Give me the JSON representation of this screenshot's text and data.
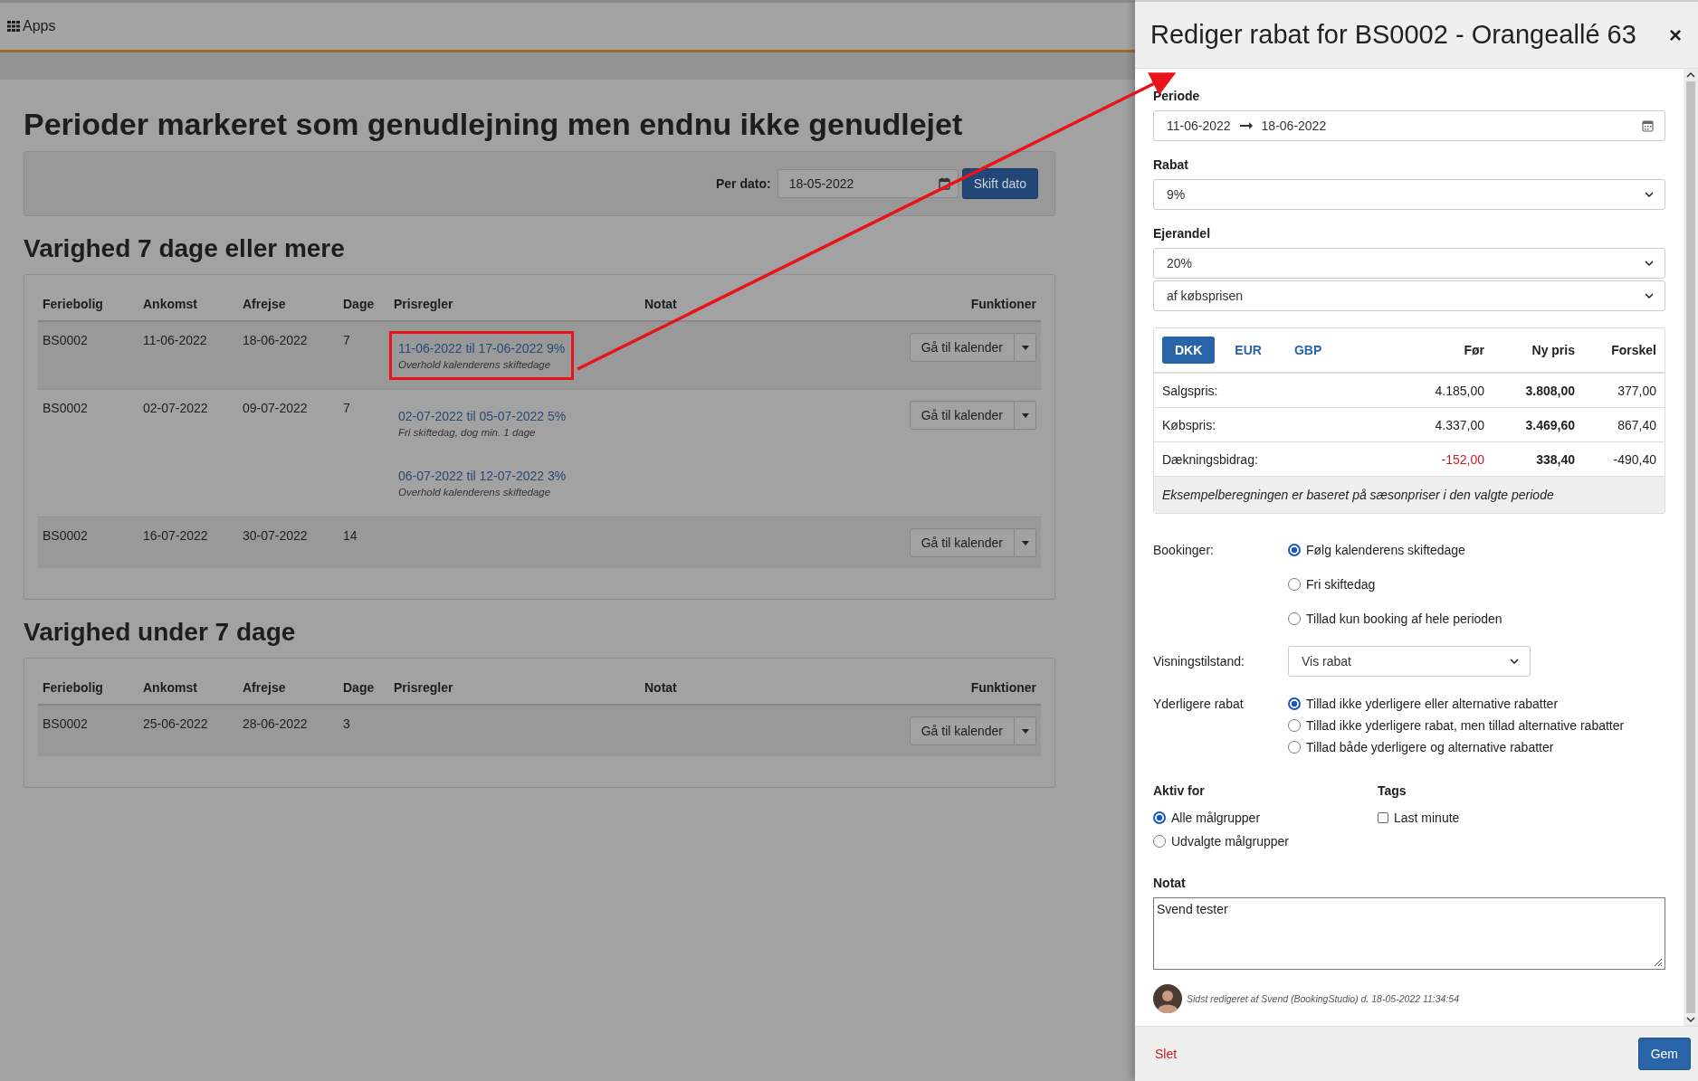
{
  "topbar": {
    "apps_label": "Apps"
  },
  "page_title": "Perioder markeret som genudlejning men endnu ikke genudlejet",
  "filter": {
    "label": "Per dato:",
    "date": "18-05-2022",
    "button": "Skift dato"
  },
  "sections": [
    {
      "title": "Varighed 7 dage eller mere",
      "columns": [
        "Feriebolig",
        "Ankomst",
        "Afrejse",
        "Dage",
        "Prisregler",
        "Notat",
        "Funktioner"
      ],
      "rows": [
        {
          "property": "BS0002",
          "arrival": "11-06-2022",
          "departure": "18-06-2022",
          "days": "7",
          "price_rules": [
            {
              "link": "11-06-2022 til 17-06-2022 9%",
              "note": "Overhold kalenderens skiftedage",
              "highlighted": true
            }
          ],
          "action": "Gå til kalender"
        },
        {
          "property": "BS0002",
          "arrival": "02-07-2022",
          "departure": "09-07-2022",
          "days": "7",
          "price_rules": [
            {
              "link": "02-07-2022 til 05-07-2022 5%",
              "note": "Fri skiftedag, dog min. 1 dage",
              "highlighted": false
            },
            {
              "link": "06-07-2022 til 12-07-2022 3%",
              "note": "Overhold kalenderens skiftedage",
              "highlighted": false
            }
          ],
          "action": "Gå til kalender"
        },
        {
          "property": "BS0002",
          "arrival": "16-07-2022",
          "departure": "30-07-2022",
          "days": "14",
          "price_rules": [],
          "action": "Gå til kalender"
        }
      ]
    },
    {
      "title": "Varighed under 7 dage",
      "columns": [
        "Feriebolig",
        "Ankomst",
        "Afrejse",
        "Dage",
        "Prisregler",
        "Notat",
        "Funktioner"
      ],
      "rows": [
        {
          "property": "BS0002",
          "arrival": "25-06-2022",
          "departure": "28-06-2022",
          "days": "3",
          "price_rules": [],
          "action": "Gå til kalender"
        }
      ]
    }
  ],
  "panel": {
    "title": "Rediger rabat for BS0002 - Orangeallé 63",
    "close": "×",
    "period": {
      "label": "Periode",
      "from": "11-06-2022",
      "to": "18-06-2022"
    },
    "discount": {
      "label": "Rabat",
      "value": "9%"
    },
    "owner_share": {
      "label": "Ejerandel",
      "value": "20%",
      "basis": "af købsprisen"
    },
    "price_table": {
      "currencies": [
        {
          "label": "DKK",
          "selected": true
        },
        {
          "label": "EUR",
          "selected": false
        },
        {
          "label": "GBP",
          "selected": false
        }
      ],
      "columns": [
        "Før",
        "Ny pris",
        "Forskel"
      ],
      "rows": [
        {
          "label": "Salgspris:",
          "before": "4.185,00",
          "new": "3.808,00",
          "diff": "377,00",
          "before_negative": false
        },
        {
          "label": "Købspris:",
          "before": "4.337,00",
          "new": "3.469,60",
          "diff": "867,40",
          "before_negative": false
        },
        {
          "label": "Dækningsbidrag:",
          "before": "-152,00",
          "new": "338,40",
          "diff": "-490,40",
          "before_negative": true
        }
      ],
      "note": "Eksempelberegningen er baseret på sæsonpriser i den valgte periode"
    },
    "bookings": {
      "label": "Bookinger:",
      "options": [
        {
          "label": "Følg kalenderens skiftedage",
          "selected": true
        },
        {
          "label": "Fri skiftedag",
          "selected": false
        },
        {
          "label": "Tillad kun booking af hele perioden",
          "selected": false
        }
      ]
    },
    "display_mode": {
      "label": "Visningstilstand:",
      "value": "Vis rabat"
    },
    "extra_discount": {
      "label": "Yderligere rabat",
      "options": [
        {
          "label": "Tillad ikke yderligere eller alternative rabatter",
          "selected": true
        },
        {
          "label": "Tillad ikke yderligere rabat, men tillad alternative rabatter",
          "selected": false
        },
        {
          "label": "Tillad både yderligere og alternative rabatter",
          "selected": false
        }
      ]
    },
    "active_for": {
      "label": "Aktiv for",
      "options": [
        {
          "label": "Alle målgrupper",
          "selected": true
        },
        {
          "label": "Udvalgte målgrupper",
          "selected": false
        }
      ]
    },
    "tags": {
      "label": "Tags",
      "items": [
        {
          "label": "Last minute",
          "checked": false
        }
      ]
    },
    "note": {
      "label": "Notat",
      "value": "Svend tester"
    },
    "last_edited": "Sidst redigeret af Svend (BookingStudio) d. 18-05-2022 11:34:54",
    "footer": {
      "delete": "Slet",
      "save": "Gem"
    }
  }
}
